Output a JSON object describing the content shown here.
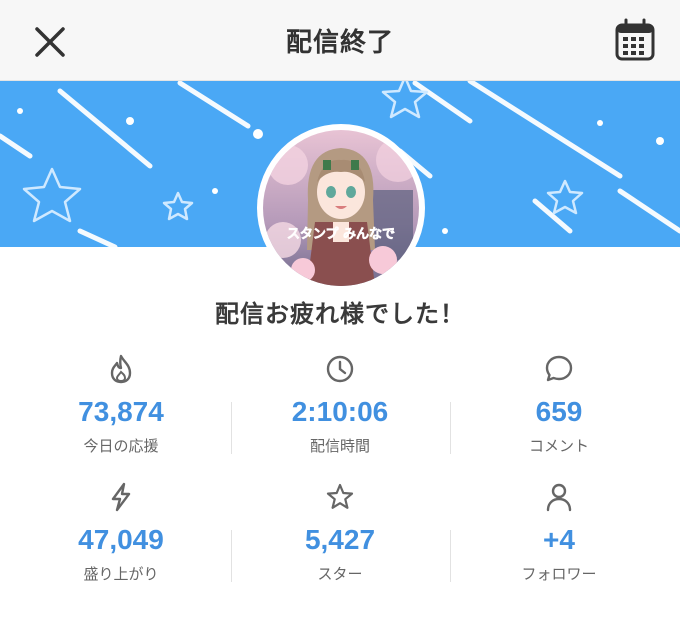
{
  "header": {
    "title": "配信終了",
    "close_icon": "close-icon",
    "calendar_icon": "calendar-icon"
  },
  "banner": {
    "background_color": "#4aa8f5",
    "decoration": "star-and-streak-icons"
  },
  "avatar": {
    "art_text": "スタンプ みんなで"
  },
  "message": "配信お疲れ様でした！",
  "stats": [
    [
      {
        "icon": "flame-icon",
        "value": "73,874",
        "label": "今日の応援"
      },
      {
        "icon": "clock-icon",
        "value": "2:10:06",
        "label": "配信時間"
      },
      {
        "icon": "speech-bubble-icon",
        "value": "659",
        "label": "コメント"
      }
    ],
    [
      {
        "icon": "lightning-icon",
        "value": "47,049",
        "label": "盛り上がり"
      },
      {
        "icon": "star-icon",
        "value": "5,427",
        "label": "スター"
      },
      {
        "icon": "person-icon",
        "value": "+4",
        "label": "フォロワー"
      }
    ]
  ],
  "colors": {
    "accent": "#4190e0",
    "label": "#666666",
    "header_bg": "#f7f7f7"
  }
}
